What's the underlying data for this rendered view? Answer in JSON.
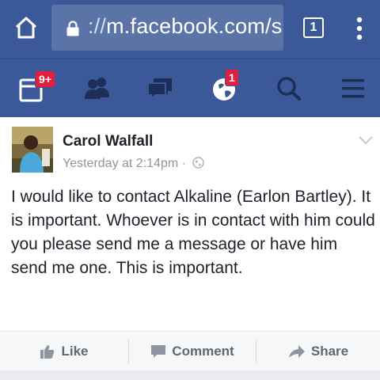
{
  "browser": {
    "url_prefix": "://",
    "url_host": "m.facebook.com/s",
    "tab_count": "1"
  },
  "nav": {
    "requests_badge": "9+",
    "notifications_badge": "1"
  },
  "post": {
    "author": "Carol Walfall",
    "timestamp": "Yesterday at 2:14pm",
    "separator": "·",
    "text": "I would like to contact Alkaline (Earlon Bartley). It is important. Whoever is in contact with him could you please send me a message or have him send me one. This is important."
  },
  "actions": {
    "like": "Like",
    "comment": "Comment",
    "share": "Share"
  },
  "colors": {
    "brand": "#3b5998",
    "badge": "#e41e3f",
    "text": "#1d2129",
    "muted": "#90949c"
  },
  "icons": [
    "home-icon",
    "lock-icon",
    "tab-switcher-icon",
    "more-vert-icon",
    "friend-requests-icon",
    "friends-icon",
    "messages-icon",
    "notifications-globe-icon",
    "search-icon",
    "menu-icon",
    "globe-privacy-icon",
    "chevron-down-icon",
    "like-icon",
    "comment-icon",
    "share-icon"
  ]
}
